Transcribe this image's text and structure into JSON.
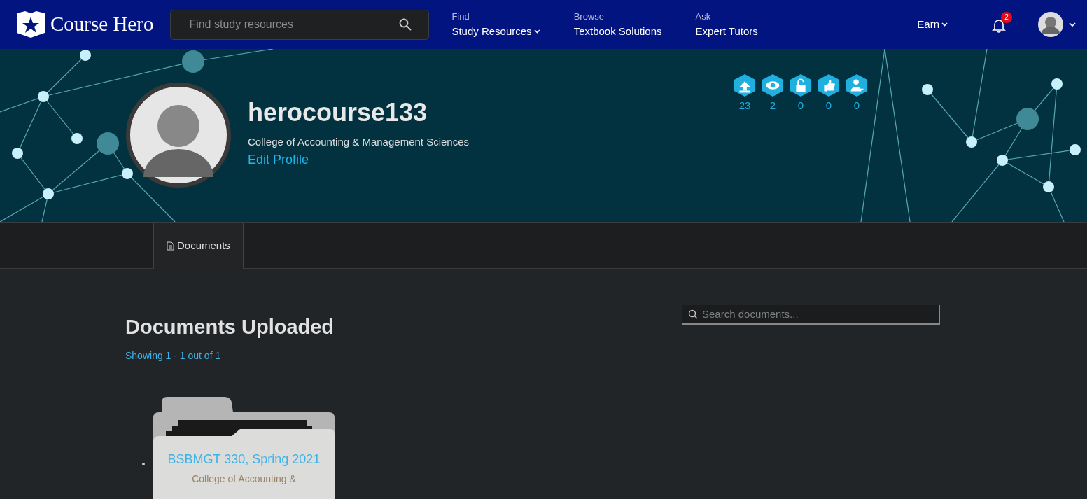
{
  "navbar": {
    "logo": "Course Hero",
    "search": {
      "placeholder": "Find study resources"
    },
    "links": [
      {
        "caption": "Find",
        "label": "Study Resources",
        "dropdown": true
      },
      {
        "caption": "Browse",
        "label": "Textbook Solutions",
        "dropdown": false
      },
      {
        "caption": "Ask",
        "label": "Expert Tutors",
        "dropdown": false
      }
    ],
    "earn": "Earn",
    "notifications": "2"
  },
  "profile": {
    "username": "herocourse133",
    "school": "College of Accounting & Management Sciences",
    "edit_link": "Edit Profile",
    "stats": [
      {
        "kind": "uploads",
        "count": "23"
      },
      {
        "kind": "views",
        "count": "2"
      },
      {
        "kind": "unlocks",
        "count": "0"
      },
      {
        "kind": "likes",
        "count": "0"
      },
      {
        "kind": "followers",
        "count": "0"
      }
    ]
  },
  "tabs": [
    {
      "label": "Documents",
      "selected": true
    }
  ],
  "documents": {
    "title": "Documents Uploaded",
    "showing": "Showing 1 - 1 out of 1",
    "search": {
      "placeholder": "Search documents..."
    },
    "folders": [
      {
        "title": "BSBMGT 330, Spring 2021",
        "school": "College of Accounting &"
      }
    ]
  }
}
